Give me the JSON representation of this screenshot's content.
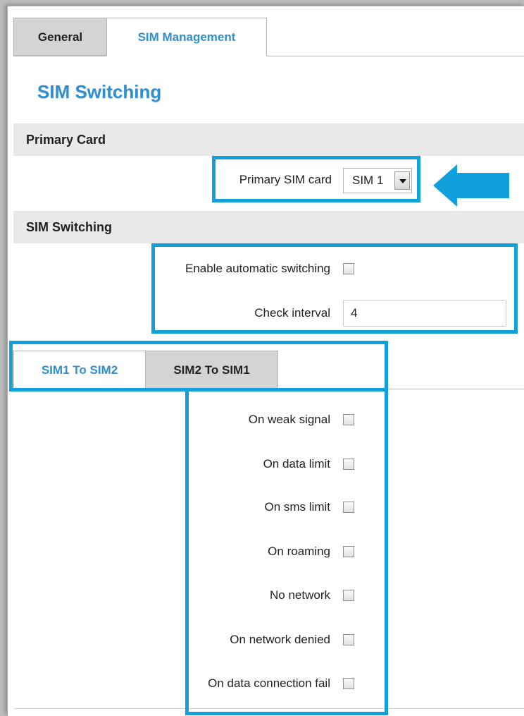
{
  "tabs": [
    {
      "label": "General",
      "active": false
    },
    {
      "label": "SIM Management",
      "active": true
    }
  ],
  "page_title": "SIM Switching",
  "sections": {
    "primary_card": "Primary Card",
    "sim_switching": "SIM Switching"
  },
  "primary_sim": {
    "label": "Primary SIM card",
    "value": "SIM 1"
  },
  "enable_switching": {
    "label": "Enable automatic switching",
    "checked": false
  },
  "check_interval": {
    "label": "Check interval",
    "value": "4"
  },
  "sub_tabs": [
    {
      "label": "SIM1 To SIM2",
      "active": true
    },
    {
      "label": "SIM2 To SIM1",
      "active": false
    }
  ],
  "conditions": [
    {
      "label": "On weak signal",
      "checked": false
    },
    {
      "label": "On data limit",
      "checked": false
    },
    {
      "label": "On sms limit",
      "checked": false
    },
    {
      "label": "On roaming",
      "checked": false
    },
    {
      "label": "No network",
      "checked": false
    },
    {
      "label": "On network denied",
      "checked": false
    },
    {
      "label": "On data connection fail",
      "checked": false
    }
  ],
  "colors": {
    "accent": "#2f8fce",
    "highlight": "#12a0dc",
    "section_bg": "#e9e9e9"
  }
}
